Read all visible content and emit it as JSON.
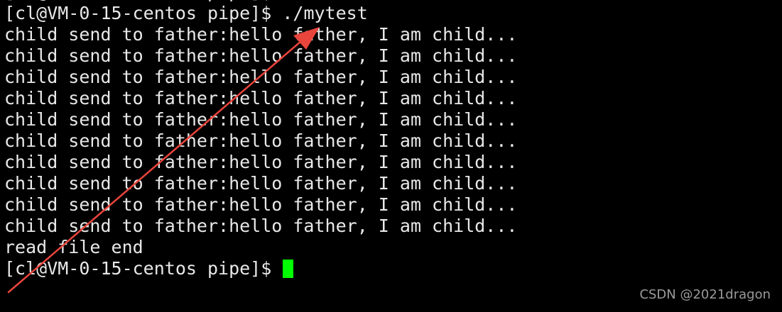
{
  "terminal": {
    "prompt": "[cl@VM-0-15-centos pipe]$ ",
    "command": "./mytest",
    "output": [
      "child send to father:hello father, I am child...",
      "child send to father:hello father, I am child...",
      "child send to father:hello father, I am child...",
      "child send to father:hello father, I am child...",
      "child send to father:hello father, I am child...",
      "child send to father:hello father, I am child...",
      "child send to father:hello father, I am child...",
      "child send to father:hello father, I am child...",
      "child send to father:hello father, I am child...",
      "child send to father:hello father, I am child...",
      "read file end"
    ],
    "final_prompt": "[cl@VM-0-15-centos pipe]$ "
  },
  "watermark": "CSDN @2021dragon",
  "colors": {
    "background": "#000000",
    "text": "#e8e8e8",
    "cursor": "#00ff00",
    "annotation_arrow": "#e8453c",
    "watermark": "#9a9a9a"
  },
  "icons": {
    "cursor": "block-cursor",
    "annotation": "red-arrow-icon"
  }
}
